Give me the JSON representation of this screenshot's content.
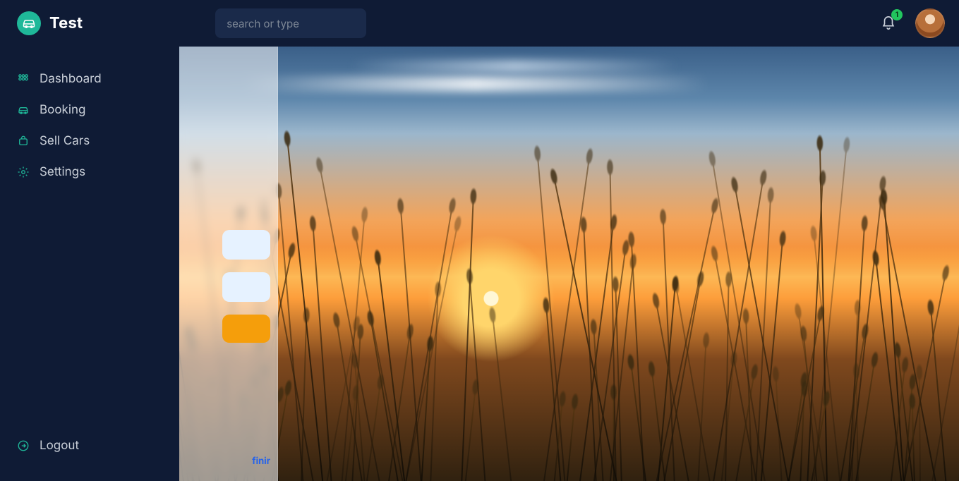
{
  "brand": {
    "title": "Test"
  },
  "header": {
    "search_placeholder": "search or type",
    "notification_count": "1"
  },
  "sidebar": {
    "items": [
      {
        "label": "Dashboard",
        "icon": "grid-icon"
      },
      {
        "label": "Booking",
        "icon": "car-icon"
      },
      {
        "label": "Sell Cars",
        "icon": "bag-icon"
      },
      {
        "label": "Settings",
        "icon": "gear-icon"
      }
    ],
    "logout_label": "Logout"
  },
  "panel": {
    "visible_link_fragment": "finir"
  },
  "colors": {
    "navy": "#0f1b35",
    "teal": "#1fb899",
    "orange": "#f59e0b",
    "input_bg": "#e6f2ff",
    "link": "#2563eb",
    "badge": "#22c55e"
  }
}
